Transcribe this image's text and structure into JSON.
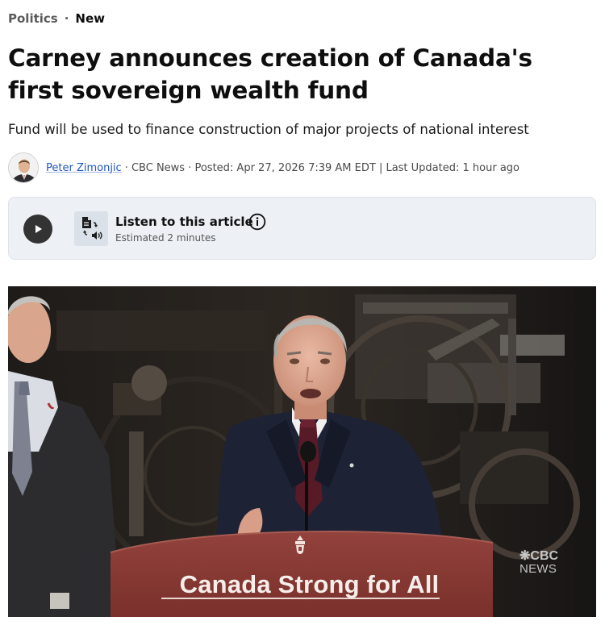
{
  "breadcrumb": {
    "section": "Politics",
    "separator": "·",
    "flag": "New"
  },
  "article": {
    "headline": "Carney announces creation of Canada's first sovereign wealth fund",
    "dek": "Fund will be used to finance construction of major projects of national interest"
  },
  "byline": {
    "author": "Peter Zimonjic",
    "meta": "· CBC News · Posted: Apr 27, 2026 7:39 AM EDT | Last Updated: 1 hour ago"
  },
  "listen": {
    "title": "Listen to this article",
    "duration": "Estimated 2 minutes",
    "icons": {
      "play": "play-icon",
      "doc": "document-audio-icon",
      "info": "info-icon"
    }
  },
  "photo": {
    "podium_text": "Canada Strong for All",
    "watermark_line1": "CBC",
    "watermark_line2": "NEWS"
  },
  "colors": {
    "link": "#1f57c3",
    "podium": "#8a3b36",
    "panel": "#edf1f5"
  }
}
